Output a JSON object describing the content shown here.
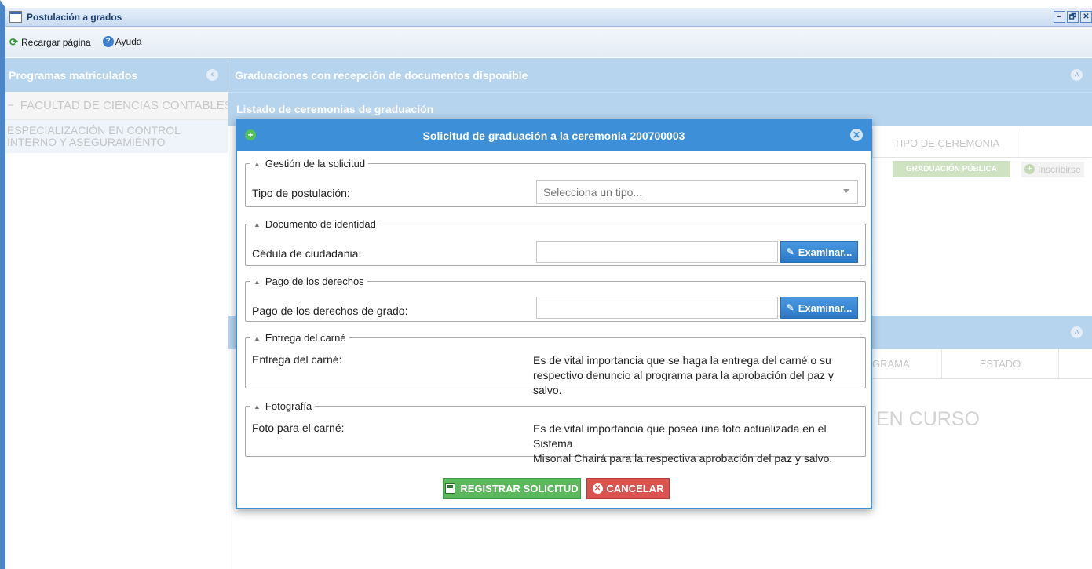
{
  "window": {
    "title": "Postulación a grados",
    "controls": [
      "–",
      "🗗",
      "✕"
    ]
  },
  "toolbar": {
    "reload_label": "Recargar página",
    "help_label": "Ayuda"
  },
  "left_panel": {
    "title": "Programas matriculados",
    "faculty": "FACULTAD DE CIENCIAS CONTABLES E",
    "program_line1": "ESPECIALIZACIÓN EN CONTROL",
    "program_line2": "INTERNO Y ASEGURAMIENTO"
  },
  "main_panel": {
    "title": "Graduaciones con recepción de documentos disponible",
    "subtitle": "Listado de ceremonias de graduación",
    "ceremony_column": "TIPO DE CEREMONIA",
    "ceremony_type_badge": "GRADUACIÓN PÚBLICA",
    "enroll_label": "Inscribirse",
    "status_columns": [
      "GRAMA",
      "ESTADO"
    ],
    "in_progress_text": "EN CURSO"
  },
  "modal": {
    "title": "Solicitud de graduación a la ceremonia 200700003",
    "groups": {
      "request": {
        "legend": "Gestión de la solicitud",
        "label": "Tipo de postulación:",
        "select_placeholder": "Selecciona un tipo..."
      },
      "identity": {
        "legend": "Documento de identidad",
        "label": "Cédula de ciudadania:",
        "browse_label": "Examinar..."
      },
      "payment": {
        "legend": "Pago de los derechos",
        "label": "Pago de los derechos de grado:",
        "browse_label": "Examinar..."
      },
      "card": {
        "legend": "Entrega del carné",
        "label": "Entrega del carné:",
        "text_line1": "Es de vital importancia que se haga la entrega del carné o su",
        "text_line2": "respectivo denuncio al programa para la aprobación del paz y salvo."
      },
      "photo": {
        "legend": "Fotografía",
        "label": "Foto para el carné:",
        "text_line1": "Es de vital importancia que posea una foto actualizada en el Sistema",
        "text_line2": "Misonal Chairá para la respectiva aprobación del paz y salvo."
      }
    },
    "register_label": "REGISTRAR SOLICITUD",
    "cancel_label": "CANCELAR"
  },
  "colors": {
    "accent": "#3d8fd8",
    "panel_header": "#b7d4ee",
    "success": "#5cb85c",
    "danger": "#d9534f"
  }
}
